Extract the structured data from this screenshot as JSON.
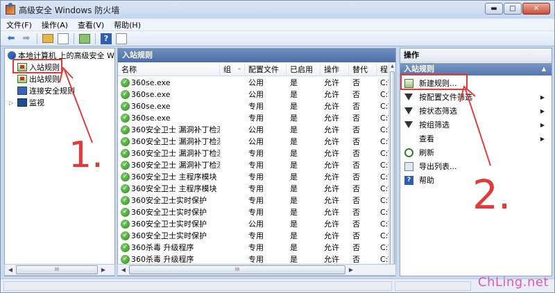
{
  "window": {
    "title": "高级安全 Windows 防火墙",
    "buttons": {
      "minimize": "▬",
      "maximize": "□",
      "close": "✕"
    }
  },
  "menu": [
    "文件(F)",
    "操作(A)",
    "查看(V)",
    "帮助(H)"
  ],
  "toolbar": {
    "icons": [
      "back-arrow-icon",
      "forward-arrow-icon",
      "up-folder-icon",
      "show-hide-tree-icon",
      "export-icon",
      "help-icon",
      "show-hide-action-pane-icon"
    ]
  },
  "tree": {
    "root": "本地计算机 上的高级安全 Windows 防火墙",
    "items": [
      {
        "label": "入站规则",
        "selected": true
      },
      {
        "label": "出站规则"
      },
      {
        "label": "连接安全规则"
      },
      {
        "label": "监视",
        "expander": "▷"
      }
    ]
  },
  "main": {
    "title": "入站规则",
    "columns": [
      "名称",
      "组",
      "配置文件",
      "已启用",
      "操作",
      "替代",
      "程"
    ],
    "rows": [
      {
        "name": "360se.exe",
        "group": "",
        "profile": "公用",
        "enabled": "是",
        "action": "允许",
        "override": "否",
        "program": "C:\\"
      },
      {
        "name": "360se.exe",
        "group": "",
        "profile": "公用",
        "enabled": "是",
        "action": "允许",
        "override": "否",
        "program": "C:\\"
      },
      {
        "name": "360se.exe",
        "group": "",
        "profile": "专用",
        "enabled": "是",
        "action": "允许",
        "override": "否",
        "program": "C:\\"
      },
      {
        "name": "360se.exe",
        "group": "",
        "profile": "专用",
        "enabled": "是",
        "action": "允许",
        "override": "否",
        "program": "C:\\"
      },
      {
        "name": "360安全卫士 漏洞补丁检测...",
        "group": "",
        "profile": "公用",
        "enabled": "是",
        "action": "允许",
        "override": "否",
        "program": "C:\\"
      },
      {
        "name": "360安全卫士 漏洞补丁检测...",
        "group": "",
        "profile": "公用",
        "enabled": "是",
        "action": "允许",
        "override": "否",
        "program": "C:\\"
      },
      {
        "name": "360安全卫士 漏洞补丁检测...",
        "group": "",
        "profile": "专用",
        "enabled": "是",
        "action": "允许",
        "override": "否",
        "program": "C:\\"
      },
      {
        "name": "360安全卫士 漏洞补丁检测...",
        "group": "",
        "profile": "专用",
        "enabled": "是",
        "action": "允许",
        "override": "否",
        "program": "C:\\"
      },
      {
        "name": "360安全卫士 主程序模块",
        "group": "",
        "profile": "专用",
        "enabled": "是",
        "action": "允许",
        "override": "否",
        "program": "C:\\"
      },
      {
        "name": "360安全卫士 主程序模块",
        "group": "",
        "profile": "专用",
        "enabled": "是",
        "action": "允许",
        "override": "否",
        "program": "C:\\"
      },
      {
        "name": "360安全卫士实时保护",
        "group": "",
        "profile": "专用",
        "enabled": "是",
        "action": "允许",
        "override": "否",
        "program": "C:\\"
      },
      {
        "name": "360安全卫士实时保护",
        "group": "",
        "profile": "专用",
        "enabled": "是",
        "action": "允许",
        "override": "否",
        "program": "C:\\"
      },
      {
        "name": "360安全卫士实时保护",
        "group": "",
        "profile": "公用",
        "enabled": "是",
        "action": "允许",
        "override": "否",
        "program": "C:\\"
      },
      {
        "name": "360安全卫士实时保护",
        "group": "",
        "profile": "专用",
        "enabled": "是",
        "action": "允许",
        "override": "否",
        "program": "C:\\"
      },
      {
        "name": "360杀毒 升级程序",
        "group": "",
        "profile": "专用",
        "enabled": "是",
        "action": "允许",
        "override": "否",
        "program": "C:\\"
      },
      {
        "name": "360杀毒 升级程序",
        "group": "",
        "profile": "专用",
        "enabled": "是",
        "action": "允许",
        "override": "否",
        "program": "C:\\"
      }
    ]
  },
  "actions": {
    "header": "操作",
    "section": "入站规则",
    "collapse_caret": "▲",
    "items": [
      {
        "label": "新建规则...",
        "icon": "new-rule-icon"
      },
      {
        "label": "按配置文件筛选",
        "icon": "filter-icon",
        "submenu": "▶"
      },
      {
        "label": "按状态筛选",
        "icon": "filter-icon",
        "submenu": "▶"
      },
      {
        "label": "按组筛选",
        "icon": "filter-icon",
        "submenu": "▶"
      },
      {
        "label": "查看",
        "icon": "",
        "submenu": "▶"
      },
      {
        "label": "刷新",
        "icon": "refresh-icon"
      },
      {
        "label": "导出列表...",
        "icon": "export-list-icon"
      },
      {
        "label": "帮助",
        "icon": "help-icon"
      }
    ]
  },
  "annotations": {
    "step1": "1.",
    "step2": "2."
  },
  "watermark": "ChLing.net",
  "colors": {
    "annotation_red": "#e23a3a",
    "watermark": "#e257b7",
    "pane_title_blue": "#5677ad"
  }
}
